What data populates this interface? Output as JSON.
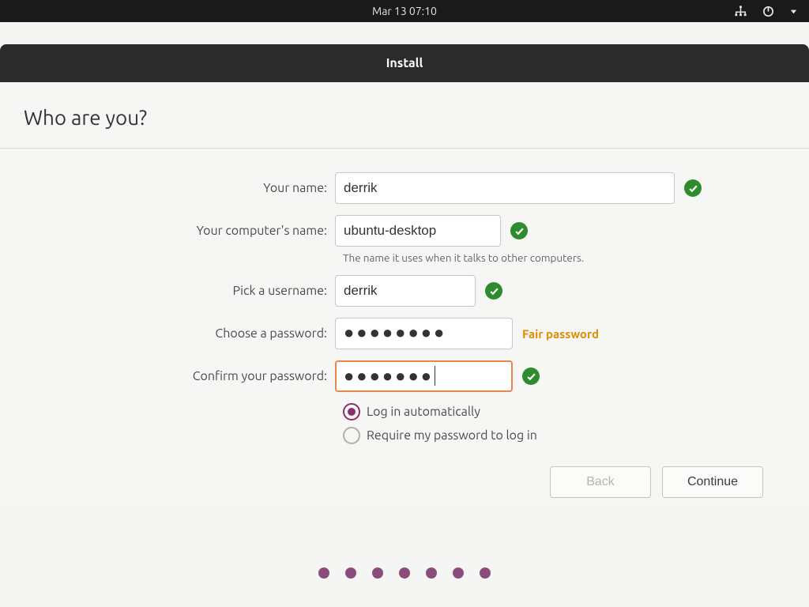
{
  "topbar": {
    "datetime": "Mar 13  07:10"
  },
  "window": {
    "title": "Install"
  },
  "page": {
    "heading": "Who are you?"
  },
  "form": {
    "name_label": "Your name:",
    "name_value": "derrik",
    "computer_label": "Your computer's name:",
    "computer_value": "ubuntu-desktop",
    "computer_helper": "The name it uses when it talks to other computers.",
    "username_label": "Pick a username:",
    "username_value": "derrik",
    "password_label": "Choose a password:",
    "password_value": "●●●●●●●●",
    "password_strength": "Fair password",
    "confirm_label": "Confirm your password:",
    "confirm_value": "●●●●●●●",
    "auto_login_label": "Log in automatically",
    "require_pw_label": "Require my password to log in",
    "login_option": "auto"
  },
  "buttons": {
    "back": "Back",
    "continue": "Continue"
  },
  "progress": {
    "steps": 7
  }
}
